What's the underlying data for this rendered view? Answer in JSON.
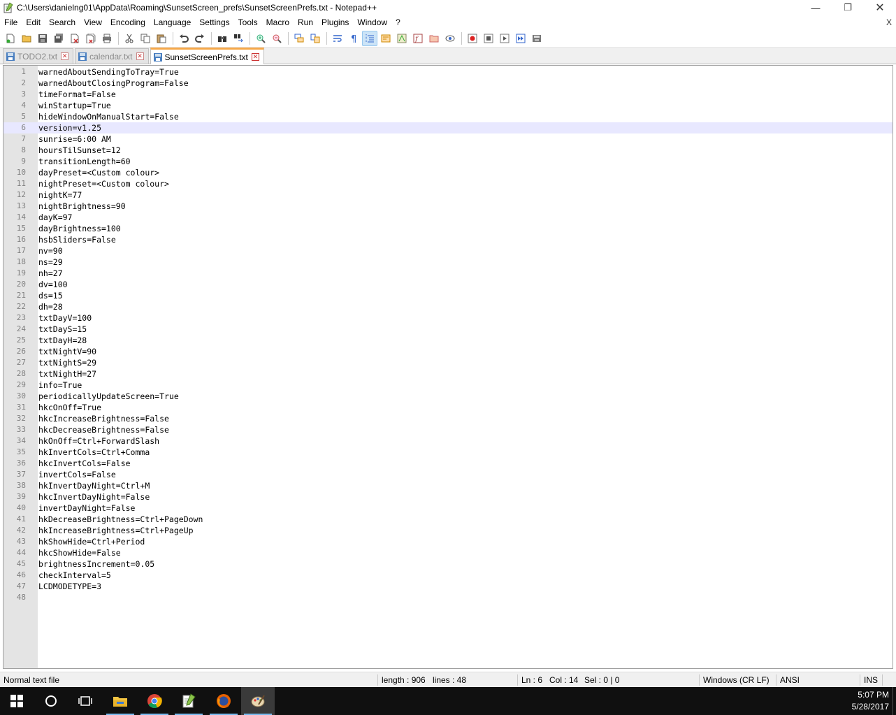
{
  "window": {
    "title": "C:\\Users\\danielng01\\AppData\\Roaming\\SunsetScreen_prefs\\SunsetScreenPrefs.txt - Notepad++",
    "minimize_icon": "minimize-icon",
    "maximize_icon": "restore-icon",
    "close_icon": "close-icon"
  },
  "menu": {
    "items": [
      "File",
      "Edit",
      "Search",
      "View",
      "Encoding",
      "Language",
      "Settings",
      "Tools",
      "Macro",
      "Run",
      "Plugins",
      "Window",
      "?"
    ],
    "close_label": "X"
  },
  "toolbar": {
    "icons": [
      "new-file-icon",
      "open-file-icon",
      "save-icon",
      "save-all-icon",
      "close-file-icon",
      "close-all-icon",
      "print-icon",
      "cut-icon",
      "copy-icon",
      "paste-icon",
      "undo-icon",
      "redo-icon",
      "find-icon",
      "replace-icon",
      "zoom-in-icon",
      "zoom-out-icon",
      "sync-vertical-icon",
      "sync-horizontal-icon",
      "word-wrap-icon",
      "show-all-characters-icon",
      "indent-guide-icon",
      "user-language-icon",
      "document-map-icon",
      "function-list-icon",
      "folder-as-workspace-icon",
      "monitoring-icon",
      "record-macro-icon",
      "stop-recording-icon",
      "playback-macro-icon",
      "run-macro-multiple-icon",
      "save-macro-icon"
    ]
  },
  "tabs": [
    {
      "label": "TODO2.txt",
      "active": false
    },
    {
      "label": "calendar.txt",
      "active": false
    },
    {
      "label": "SunsetScreenPrefs.txt",
      "active": true
    }
  ],
  "editor": {
    "current_line": 6,
    "lines": [
      "warnedAboutSendingToTray=True",
      "warnedAboutClosingProgram=False",
      "timeFormat=False",
      "winStartup=True",
      "hideWindowOnManualStart=False",
      "version=v1.25",
      "sunrise=6:00 AM",
      "hoursTilSunset=12",
      "transitionLength=60",
      "dayPreset=<Custom colour>",
      "nightPreset=<Custom colour>",
      "nightK=77",
      "nightBrightness=90",
      "dayK=97",
      "dayBrightness=100",
      "hsbSliders=False",
      "nv=90",
      "ns=29",
      "nh=27",
      "dv=100",
      "ds=15",
      "dh=28",
      "txtDayV=100",
      "txtDayS=15",
      "txtDayH=28",
      "txtNightV=90",
      "txtNightS=29",
      "txtNightH=27",
      "info=True",
      "periodicallyUpdateScreen=True",
      "hkcOnOff=True",
      "hkcIncreaseBrightness=False",
      "hkcDecreaseBrightness=False",
      "hkOnOff=Ctrl+ForwardSlash",
      "hkInvertCols=Ctrl+Comma",
      "hkcInvertCols=False",
      "invertCols=False",
      "hkInvertDayNight=Ctrl+M",
      "hkcInvertDayNight=False",
      "invertDayNight=False",
      "hkDecreaseBrightness=Ctrl+PageDown",
      "hkIncreaseBrightness=Ctrl+PageUp",
      "hkShowHide=Ctrl+Period",
      "hkcShowHide=False",
      "brightnessIncrement=0.05",
      "checkInterval=5",
      "LCDMODETYPE=3",
      ""
    ]
  },
  "status": {
    "file_type": "Normal text file",
    "length": "length : 906",
    "lines": "lines : 48",
    "ln": "Ln : 6",
    "col": "Col : 14",
    "sel": "Sel : 0 | 0",
    "eol": "Windows (CR LF)",
    "encoding": "ANSI",
    "mode": "INS"
  },
  "taskbar": {
    "items": [
      "windows-start-icon",
      "cortana-search-icon",
      "task-view-icon",
      "file-explorer-icon",
      "chrome-icon",
      "notepad-plus-plus-icon",
      "firefox-icon",
      "paint-icon"
    ],
    "time": "5:07 PM",
    "date": "5/28/2017"
  },
  "colors": {
    "current_line": "#e8e8ff",
    "gutter": "#e4e4e4",
    "active_tab_accent": "#f6a84a",
    "taskbar": "#101010"
  }
}
